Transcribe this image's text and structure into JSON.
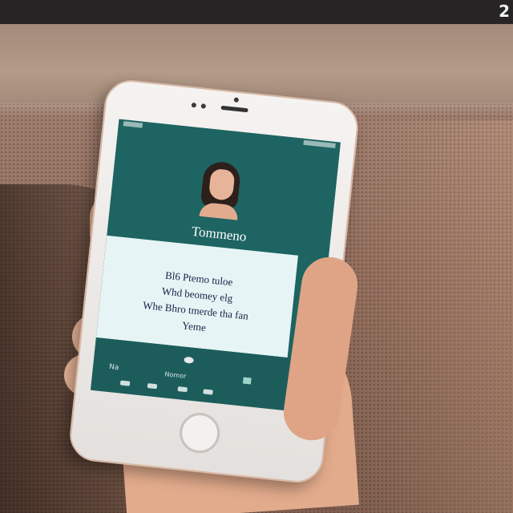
{
  "header": {
    "corner_glyph": "2"
  },
  "phone": {
    "screen": {
      "profile_name": "Tommeno",
      "message_lines": [
        "Bl6 Ptemo tuloe",
        "Whd beomey elg",
        "Whe Bhro tmerde tha fan",
        "Yeme"
      ],
      "nav": {
        "left_label": "Na",
        "center_label": "Nomor"
      },
      "colors": {
        "header": "#1d6462",
        "card": "#e6f4f5",
        "bottom": "#1c5d5c"
      }
    }
  }
}
